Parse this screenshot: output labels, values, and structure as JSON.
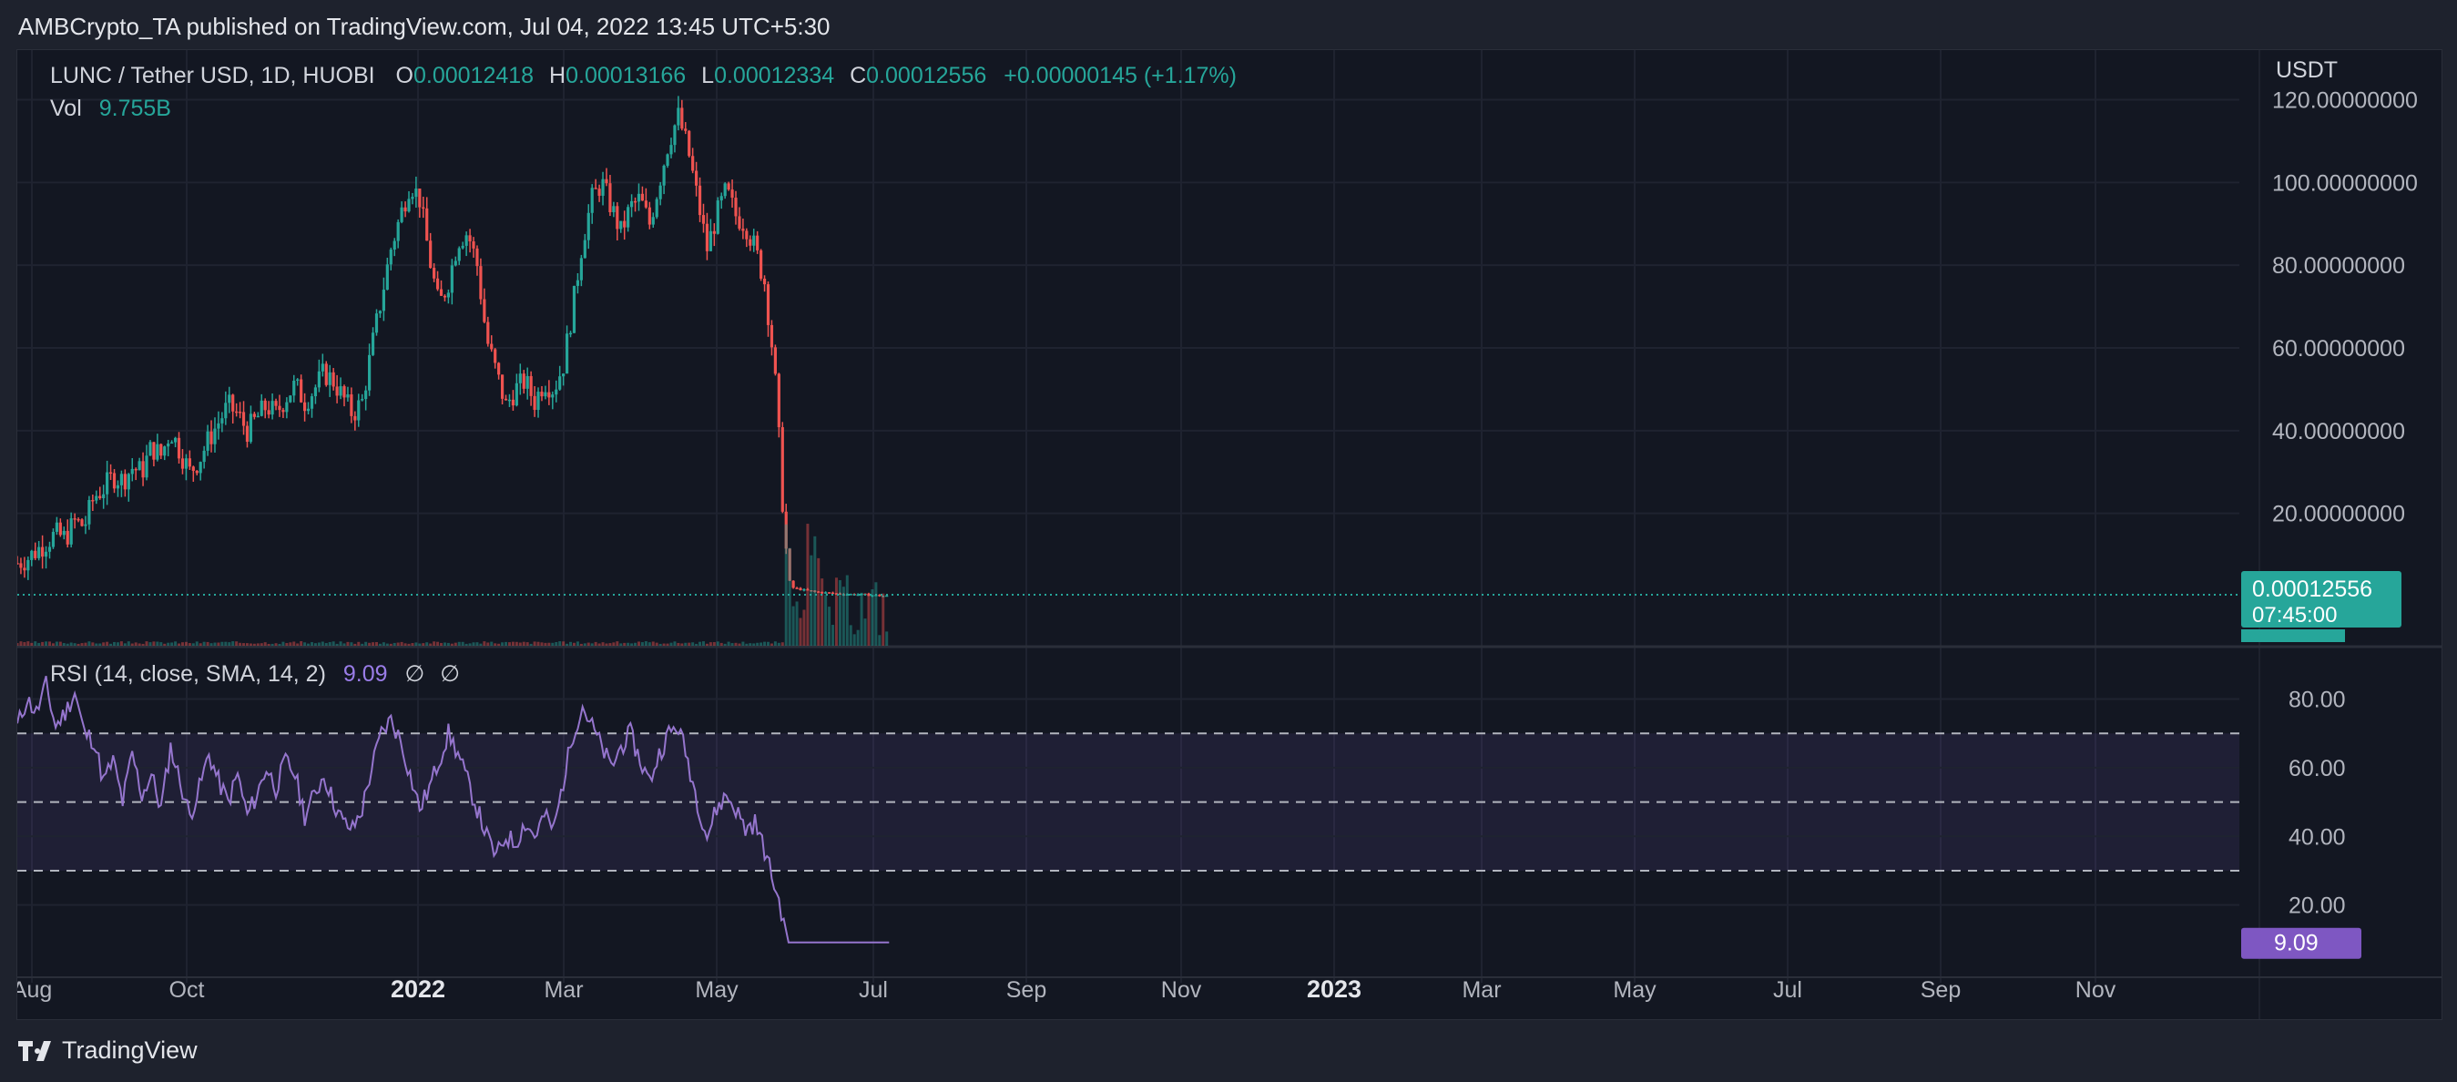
{
  "header": {
    "published": "AMBCrypto_TA published on TradingView.com, Jul 04, 2022 13:45 UTC+5:30"
  },
  "legend": {
    "symbol": "LUNC / Tether USD, 1D, HUOBI",
    "open_label": "O",
    "open": "0.00012418",
    "high_label": "H",
    "high": "0.00013166",
    "low_label": "L",
    "low": "0.00012334",
    "close_label": "C",
    "close": "0.00012556",
    "change": "+0.00000145 (+1.17%)",
    "vol_label": "Vol",
    "vol": "9.755B"
  },
  "rsi": {
    "label": "RSI (14, close, SMA, 14, 2)",
    "value": "9.09",
    "extra1": "∅",
    "extra2": "∅"
  },
  "footer": {
    "brand": "TradingView"
  },
  "colors": {
    "up": "#26a69a",
    "down": "#ef5350",
    "rsi_line": "#7e57c2",
    "rsi_band": "#7e57c2",
    "price_label_bg": "#26a69a",
    "rsi_label_bg": "#7e57c2"
  },
  "chart_data": [
    {
      "type": "candlestick",
      "currency": "USDT",
      "y_ticks": [
        "120.00000000",
        "100.00000000",
        "80.00000000",
        "60.00000000",
        "40.00000000",
        "20.00000000"
      ],
      "y_tick_values": [
        120,
        100,
        80,
        60,
        40,
        20
      ],
      "ylim": [
        -12,
        132
      ],
      "x_ticks": [
        {
          "label": "Aug",
          "bold": false
        },
        {
          "label": "Oct",
          "bold": false
        },
        {
          "label": "2022",
          "bold": true
        },
        {
          "label": "Mar",
          "bold": false
        },
        {
          "label": "May",
          "bold": false
        },
        {
          "label": "Jul",
          "bold": false
        },
        {
          "label": "Sep",
          "bold": false
        },
        {
          "label": "Nov",
          "bold": false
        },
        {
          "label": "2023",
          "bold": true
        },
        {
          "label": "Mar",
          "bold": false
        },
        {
          "label": "May",
          "bold": false
        },
        {
          "label": "Jul",
          "bold": false
        },
        {
          "label": "Sep",
          "bold": false
        },
        {
          "label": "Nov",
          "bold": false
        }
      ],
      "price_close_series": [
        [
          0,
          8
        ],
        [
          4,
          9
        ],
        [
          8,
          11
        ],
        [
          12,
          13
        ],
        [
          16,
          15
        ],
        [
          20,
          14
        ],
        [
          24,
          18
        ],
        [
          28,
          17
        ],
        [
          32,
          24
        ],
        [
          36,
          26
        ],
        [
          40,
          29
        ],
        [
          44,
          28
        ],
        [
          48,
          31
        ],
        [
          52,
          30
        ],
        [
          56,
          36
        ],
        [
          60,
          34
        ],
        [
          64,
          40
        ],
        [
          68,
          35
        ],
        [
          72,
          30
        ],
        [
          76,
          33
        ],
        [
          80,
          38
        ],
        [
          84,
          42
        ],
        [
          88,
          46
        ],
        [
          92,
          44
        ],
        [
          96,
          40
        ],
        [
          100,
          43
        ],
        [
          104,
          46
        ],
        [
          108,
          44
        ],
        [
          112,
          48
        ],
        [
          116,
          51
        ],
        [
          120,
          47
        ],
        [
          124,
          50
        ],
        [
          128,
          54
        ],
        [
          132,
          52
        ],
        [
          136,
          48
        ],
        [
          140,
          44
        ],
        [
          144,
          47
        ],
        [
          148,
          60
        ],
        [
          152,
          72
        ],
        [
          156,
          84
        ],
        [
          160,
          92
        ],
        [
          164,
          100
        ],
        [
          168,
          96
        ],
        [
          172,
          82
        ],
        [
          176,
          70
        ],
        [
          180,
          76
        ],
        [
          184,
          86
        ],
        [
          188,
          88
        ],
        [
          192,
          80
        ],
        [
          196,
          62
        ],
        [
          200,
          54
        ],
        [
          204,
          46
        ],
        [
          208,
          50
        ],
        [
          212,
          52
        ],
        [
          216,
          47
        ],
        [
          220,
          52
        ],
        [
          224,
          50
        ],
        [
          228,
          56
        ],
        [
          232,
          70
        ],
        [
          236,
          86
        ],
        [
          240,
          96
        ],
        [
          244,
          100
        ],
        [
          248,
          94
        ],
        [
          252,
          88
        ],
        [
          256,
          94
        ],
        [
          260,
          96
        ],
        [
          264,
          90
        ],
        [
          268,
          100
        ],
        [
          272,
          110
        ],
        [
          276,
          116
        ],
        [
          280,
          108
        ],
        [
          284,
          96
        ],
        [
          288,
          84
        ],
        [
          292,
          92
        ],
        [
          296,
          98
        ],
        [
          300,
          92
        ],
        [
          304,
          90
        ],
        [
          308,
          84
        ],
        [
          312,
          76
        ],
        [
          316,
          56
        ],
        [
          318,
          38
        ],
        [
          320,
          18
        ],
        [
          322,
          4
        ],
        [
          324,
          2
        ],
        [
          328,
          1.5
        ],
        [
          334,
          1
        ],
        [
          340,
          0.7
        ],
        [
          346,
          0.5
        ],
        [
          352,
          0.4
        ],
        [
          358,
          0.2
        ],
        [
          364,
          0.00012556
        ]
      ],
      "last_price": "0.00012556",
      "countdown": "07:45:00",
      "last_label_hidden_part": "9.755B"
    },
    {
      "type": "line",
      "name": "RSI (14, close, SMA, 14, 2)",
      "y_ticks": [
        "80.00",
        "60.00",
        "40.00",
        "20.00"
      ],
      "y_tick_values": [
        80,
        60,
        40,
        20
      ],
      "ylim": [
        0,
        95
      ],
      "bands": {
        "upper": 70,
        "middle": 50,
        "lower": 30
      },
      "rsi_series": [
        [
          0,
          72
        ],
        [
          4,
          80
        ],
        [
          8,
          76
        ],
        [
          12,
          84
        ],
        [
          16,
          72
        ],
        [
          20,
          76
        ],
        [
          24,
          82
        ],
        [
          28,
          70
        ],
        [
          32,
          68
        ],
        [
          36,
          56
        ],
        [
          40,
          62
        ],
        [
          44,
          50
        ],
        [
          48,
          64
        ],
        [
          52,
          52
        ],
        [
          56,
          58
        ],
        [
          60,
          48
        ],
        [
          64,
          66
        ],
        [
          68,
          56
        ],
        [
          72,
          46
        ],
        [
          76,
          54
        ],
        [
          80,
          64
        ],
        [
          84,
          56
        ],
        [
          88,
          50
        ],
        [
          92,
          58
        ],
        [
          96,
          46
        ],
        [
          100,
          52
        ],
        [
          104,
          60
        ],
        [
          108,
          54
        ],
        [
          112,
          62
        ],
        [
          116,
          58
        ],
        [
          120,
          46
        ],
        [
          124,
          52
        ],
        [
          128,
          58
        ],
        [
          132,
          50
        ],
        [
          136,
          44
        ],
        [
          140,
          42
        ],
        [
          144,
          48
        ],
        [
          148,
          60
        ],
        [
          152,
          70
        ],
        [
          156,
          74
        ],
        [
          160,
          68
        ],
        [
          164,
          58
        ],
        [
          168,
          48
        ],
        [
          172,
          54
        ],
        [
          176,
          62
        ],
        [
          180,
          70
        ],
        [
          184,
          64
        ],
        [
          188,
          56
        ],
        [
          192,
          48
        ],
        [
          196,
          40
        ],
        [
          200,
          34
        ],
        [
          204,
          40
        ],
        [
          208,
          38
        ],
        [
          212,
          44
        ],
        [
          216,
          40
        ],
        [
          220,
          46
        ],
        [
          224,
          42
        ],
        [
          228,
          56
        ],
        [
          232,
          70
        ],
        [
          236,
          78
        ],
        [
          240,
          72
        ],
        [
          244,
          66
        ],
        [
          248,
          60
        ],
        [
          252,
          66
        ],
        [
          256,
          70
        ],
        [
          260,
          62
        ],
        [
          264,
          56
        ],
        [
          268,
          64
        ],
        [
          272,
          70
        ],
        [
          276,
          72
        ],
        [
          280,
          62
        ],
        [
          284,
          50
        ],
        [
          288,
          40
        ],
        [
          292,
          48
        ],
        [
          296,
          52
        ],
        [
          300,
          48
        ],
        [
          304,
          42
        ],
        [
          308,
          44
        ],
        [
          312,
          36
        ],
        [
          316,
          26
        ],
        [
          320,
          16
        ],
        [
          322,
          9.09
        ],
        [
          364,
          9.09
        ]
      ],
      "last_value": "9.09"
    }
  ]
}
